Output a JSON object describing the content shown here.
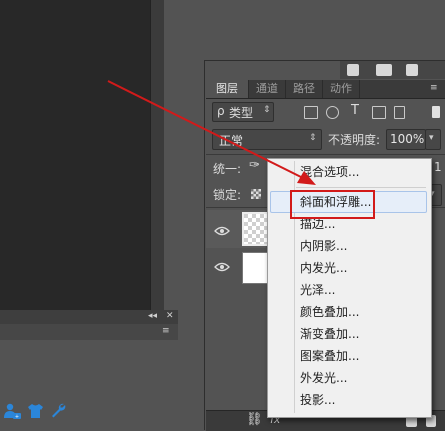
{
  "layers_panel": {
    "tabs": [
      {
        "label": "图层"
      },
      {
        "label": "通道"
      },
      {
        "label": "路径"
      },
      {
        "label": "动作"
      }
    ],
    "filter": {
      "search_glyph": "ρ",
      "type_label": "类型"
    },
    "blend": {
      "mode": "正常",
      "opacity_label": "不透明度:",
      "opacity_value": "100%"
    },
    "unify_label": "统一:",
    "lock_label": "锁定:",
    "right_edge_text": "1"
  },
  "context_menu": {
    "items": [
      {
        "label": "混合选项..."
      },
      {
        "label": "斜面和浮雕..."
      },
      {
        "label": "描边..."
      },
      {
        "label": "内阴影..."
      },
      {
        "label": "内发光..."
      },
      {
        "label": "光泽..."
      },
      {
        "label": "颜色叠加..."
      },
      {
        "label": "渐变叠加..."
      },
      {
        "label": "图案叠加..."
      },
      {
        "label": "外发光..."
      },
      {
        "label": "投影..."
      }
    ],
    "highlighted_item": "斜面和浮雕..."
  },
  "annotations": {
    "arrow_color": "#d21a1a",
    "box_color": "#d21a1a"
  },
  "bottom_toolbar": {
    "fx_label": "fx"
  },
  "bottom_left_panel": {
    "header_glyphs": "◂◂ ✕",
    "menu_glyph": "≡"
  },
  "icons": [
    "person-icon",
    "shirt-icon",
    "wrench-icon",
    "eye-icon",
    "link-icon",
    "trash-icon",
    "camera-icon",
    "new-layer-icon",
    "folder-icon",
    "mask-icon"
  ]
}
